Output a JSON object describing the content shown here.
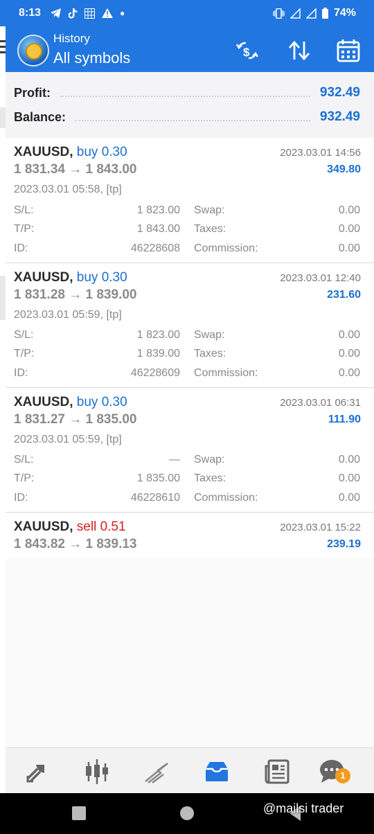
{
  "status_bar": {
    "time": "8:13",
    "battery": "74%"
  },
  "header": {
    "subtitle": "History",
    "title": "All symbols"
  },
  "summary": {
    "profit_label": "Profit:",
    "profit_value": "932.49",
    "balance_label": "Balance:",
    "balance_value": "932.49"
  },
  "deals": [
    {
      "symbol": "XAUUSD,",
      "side": "buy 0.30",
      "prices": "1 831.34 → 1 843.00",
      "close_time": "2023.03.01 14:56",
      "profit": "349.80",
      "open_time": "2023.03.01 05:58, [tp]",
      "sl_label": "S/L:",
      "sl": "1 823.00",
      "tp_label": "T/P:",
      "tp": "1 843.00",
      "id_label": "ID:",
      "id": "46228608",
      "swap_label": "Swap:",
      "swap": "0.00",
      "taxes_label": "Taxes:",
      "taxes": "0.00",
      "commission_label": "Commission:",
      "commission": "0.00"
    },
    {
      "symbol": "XAUUSD,",
      "side": "buy 0.30",
      "prices": "1 831.28 → 1 839.00",
      "close_time": "2023.03.01 12:40",
      "profit": "231.60",
      "open_time": "2023.03.01 05:59, [tp]",
      "sl_label": "S/L:",
      "sl": "1 823.00",
      "tp_label": "T/P:",
      "tp": "1 839.00",
      "id_label": "ID:",
      "id": "46228609",
      "swap_label": "Swap:",
      "swap": "0.00",
      "taxes_label": "Taxes:",
      "taxes": "0.00",
      "commission_label": "Commission:",
      "commission": "0.00"
    },
    {
      "symbol": "XAUUSD,",
      "side": "buy 0.30",
      "prices": "1 831.27 → 1 835.00",
      "close_time": "2023.03.01 06:31",
      "profit": "111.90",
      "open_time": "2023.03.01 05:59, [tp]",
      "sl_label": "S/L:",
      "sl": "—",
      "tp_label": "T/P:",
      "tp": "1 835.00",
      "id_label": "ID:",
      "id": "46228610",
      "swap_label": "Swap:",
      "swap": "0.00",
      "taxes_label": "Taxes:",
      "taxes": "0.00",
      "commission_label": "Commission:",
      "commission": "0.00"
    },
    {
      "symbol": "XAUUSD,",
      "side": "sell 0.51",
      "prices": "1 843.82 → 1 839.13",
      "close_time": "2023.03.01 15:22",
      "profit": "239.19"
    }
  ],
  "bottom_nav": {
    "chat_badge": "1"
  },
  "watermark": "@mailsi trader",
  "colors": {
    "accent": "#2176e0",
    "buy": "#1b6fd0",
    "sell": "#d21f1f"
  },
  "icons": [
    "telegram-icon",
    "tiktok-icon",
    "calendar-grid-icon",
    "warning-icon",
    "vibrate-icon",
    "signal-icon",
    "battery-icon",
    "symbols-icon",
    "sort-icon",
    "calendar-icon",
    "quotes-icon",
    "chart-icon",
    "trade-icon",
    "history-icon",
    "news-icon",
    "chat-icon"
  ]
}
